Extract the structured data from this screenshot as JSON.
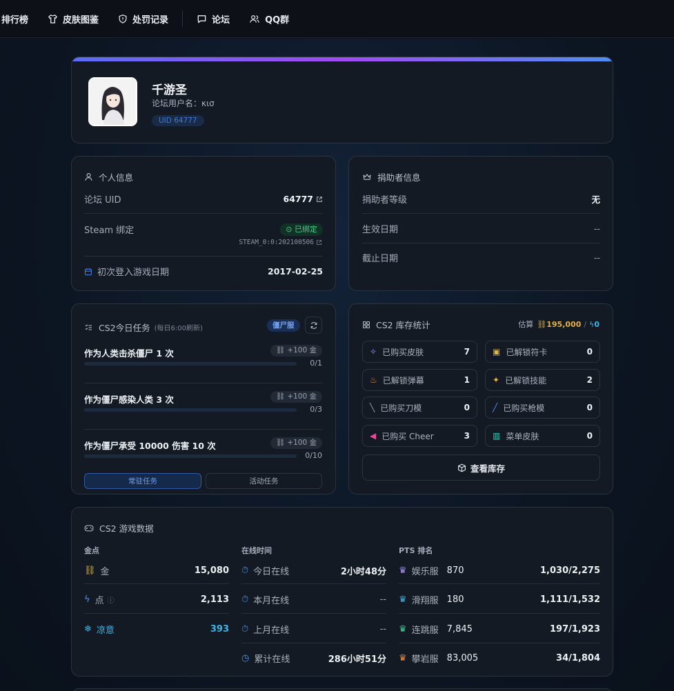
{
  "nav": {
    "items": [
      "排行榜",
      "皮肤图鉴",
      "处罚记录",
      "论坛",
      "QQ群"
    ]
  },
  "profile": {
    "name": "千游圣",
    "forum_user": "论坛用户名：κισ",
    "uid": "UID 64777"
  },
  "personal": {
    "title": "个人信息",
    "forum_uid_label": "论坛 UID",
    "forum_uid": "64777",
    "steam_label": "Steam 绑定",
    "steam_status": "已绑定",
    "steam_id": "STEAM_0:0:202100506",
    "first_login_label": "初次登入游戏日期",
    "first_login": "2017-02-25"
  },
  "donor": {
    "title": "捐助者信息",
    "rows": [
      {
        "label": "捐助者等级",
        "value": "无"
      },
      {
        "label": "生效日期",
        "value": "--"
      },
      {
        "label": "截止日期",
        "value": "--"
      }
    ]
  },
  "tasks": {
    "title": "CS2今日任务",
    "subtitle": "(每日6:00刷新)",
    "badge": "僵尸服",
    "items": [
      {
        "name": "作为人类击杀僵尸 1 次",
        "reward": "+100 金",
        "count": "0/1",
        "progress": 0
      },
      {
        "name": "作为僵尸感染人类 3 次",
        "reward": "+100 金",
        "count": "0/3",
        "progress": 0
      },
      {
        "name": "作为僵尸承受 10000 伤害 10 次",
        "reward": "+100 金",
        "count": "0/10",
        "progress": 0
      }
    ],
    "tab_regular": "常驻任务",
    "tab_event": "活动任务"
  },
  "inventory": {
    "title": "CS2 库存统计",
    "estimate_label": "估算",
    "estimate_gold": "195,000",
    "estimate_sep": "/",
    "estimate_points": "0",
    "stats": [
      {
        "label": "已购买皮肤",
        "value": "7"
      },
      {
        "label": "已解锁符卡",
        "value": "0"
      },
      {
        "label": "已解锁弹幕",
        "value": "1"
      },
      {
        "label": "已解锁技能",
        "value": "2"
      },
      {
        "label": "已购买刀模",
        "value": "0"
      },
      {
        "label": "已购买枪模",
        "value": "0"
      },
      {
        "label": "已购买 Cheer",
        "value": "3"
      },
      {
        "label": "菜单皮肤",
        "value": "0"
      }
    ],
    "view_button": "查看库存"
  },
  "game": {
    "title": "CS2 游戏数据",
    "money_header": "金点",
    "money": [
      {
        "label": "金",
        "value": "15,080"
      },
      {
        "label": "点",
        "value": "2,113"
      },
      {
        "label": "凉意",
        "value": "393"
      }
    ],
    "online_header": "在线时间",
    "online": [
      {
        "label": "今日在线",
        "value": "2小时48分"
      },
      {
        "label": "本月在线",
        "value": "--"
      },
      {
        "label": "上月在线",
        "value": "--"
      },
      {
        "label": "累计在线",
        "value": "286小时51分"
      }
    ],
    "rank_header": "PTS 排名",
    "ranks": [
      {
        "server": "娱乐服",
        "pts": "870",
        "rank": "1,030/2,275"
      },
      {
        "server": "滑翔服",
        "pts": "180",
        "rank": "1,111/1,532"
      },
      {
        "server": "连跳服",
        "pts": "7,845",
        "rank": "197/1,923"
      },
      {
        "server": "攀岩服",
        "pts": "83,005",
        "rank": "34/1,804"
      }
    ]
  },
  "colors": {
    "accent": "#3f7be0",
    "gold": "#e3b341",
    "green": "#3ecf8e",
    "cyan": "#39b6e8"
  }
}
